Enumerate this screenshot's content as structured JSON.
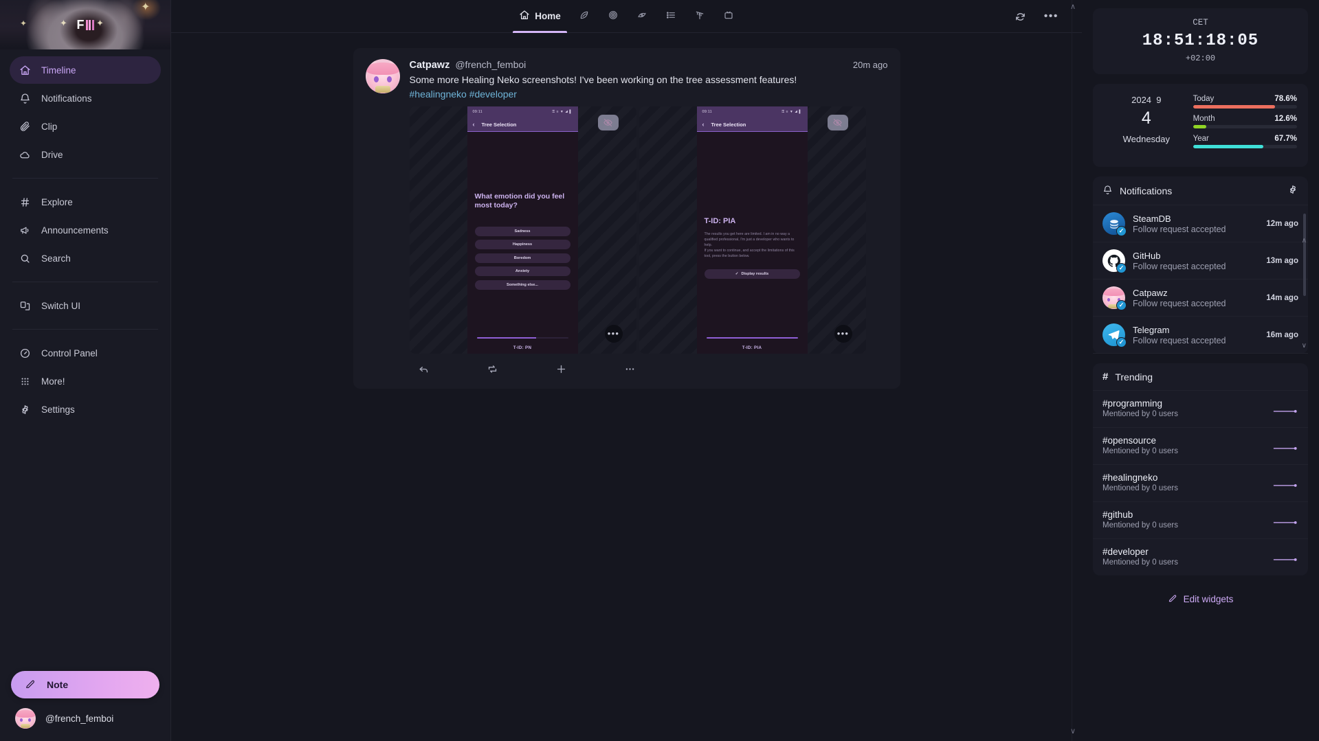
{
  "sidebar": {
    "logo": {
      "letter": "F",
      "name": "firefish-logo"
    },
    "groups": [
      {
        "items": [
          {
            "label": "Timeline",
            "icon": "home-icon",
            "active": true
          },
          {
            "label": "Notifications",
            "icon": "bell-icon",
            "active": false
          },
          {
            "label": "Clip",
            "icon": "paperclip-icon",
            "active": false
          },
          {
            "label": "Drive",
            "icon": "cloud-icon",
            "active": false
          }
        ]
      },
      {
        "items": [
          {
            "label": "Explore",
            "icon": "hash-icon",
            "active": false
          },
          {
            "label": "Announcements",
            "icon": "megaphone-icon",
            "active": false
          },
          {
            "label": "Search",
            "icon": "search-icon",
            "active": false
          }
        ]
      },
      {
        "items": [
          {
            "label": "Switch UI",
            "icon": "switch-ui-icon",
            "active": false
          }
        ]
      },
      {
        "items": [
          {
            "label": "Control Panel",
            "icon": "gauge-icon",
            "active": false
          },
          {
            "label": "More!",
            "icon": "grid-dots-icon",
            "active": false
          },
          {
            "label": "Settings",
            "icon": "gear-icon",
            "active": false
          }
        ]
      }
    ],
    "note_button": {
      "label": "Note",
      "icon": "pencil-icon"
    },
    "account": {
      "handle": "@french_femboi"
    }
  },
  "topbar": {
    "tabs": [
      {
        "label": "Home",
        "icon": "home-icon",
        "active": true
      },
      {
        "label": "",
        "icon": "leaf-icon",
        "active": false
      },
      {
        "label": "",
        "icon": "globe-icon",
        "active": false
      },
      {
        "label": "",
        "icon": "spiral-icon",
        "active": false
      },
      {
        "label": "",
        "icon": "list-icon",
        "active": false
      },
      {
        "label": "",
        "icon": "antenna-icon",
        "active": false
      },
      {
        "label": "",
        "icon": "channel-icon",
        "active": false
      }
    ],
    "refresh": "refresh-icon",
    "menu": "•••"
  },
  "post": {
    "author_name": "Catpawz",
    "author_handle": "@french_femboi",
    "timestamp": "20m ago",
    "text": "Some more Healing Neko screenshots! I've been working on the tree assessment features!",
    "tags": [
      "#healingneko",
      "#developer"
    ],
    "media": [
      {
        "hidden_icon": "eye-off-icon",
        "more_icon": "•••",
        "phone": {
          "status_time": "09:11",
          "status_icons": "⚿ ≡ ▼ ◢ ▌",
          "appbar_title": "Tree Selection",
          "back_icon": "‹",
          "heading": "What emotion did you feel most today?",
          "options": [
            "Sadness",
            "Happiness",
            "Boredom",
            "Anxiety",
            "Something else..."
          ],
          "progress_percent": 65,
          "footer": "T-ID: PN"
        }
      },
      {
        "hidden_icon": "eye-off-icon",
        "more_icon": "•••",
        "phone": {
          "status_time": "09:11",
          "status_icons": "⚿ ≡ ▼ ◢ ▌",
          "appbar_title": "Tree Selection",
          "back_icon": "‹",
          "heading": "T-ID: PIA",
          "paragraph": "The results you get here are limited. I am in no way a qualified professional, I'm just a developer who wants to help.\nIf you want to continue, and accept the limitations of this tool, press the button below.",
          "cta": "Display results",
          "cta_icon": "check-icon",
          "progress_percent": 100,
          "footer": "T-ID: PIA"
        }
      }
    ],
    "actions": [
      {
        "name": "reply",
        "icon": "reply-arrow-icon"
      },
      {
        "name": "renote",
        "icon": "repeat-icon"
      },
      {
        "name": "react",
        "icon": "plus-icon"
      },
      {
        "name": "more",
        "icon": "ellipsis-icon"
      }
    ]
  },
  "widgets": {
    "clock": {
      "timezone": "CET",
      "time": "18:51:18:05",
      "offset": "+02:00"
    },
    "calendar": {
      "year": "2024",
      "month": "9",
      "day": "4",
      "weekday": "Wednesday",
      "bars": [
        {
          "label": "Today",
          "value": "78.6%",
          "percent": 78.6,
          "color": "#ec6f5e"
        },
        {
          "label": "Month",
          "value": "12.6%",
          "percent": 12.6,
          "color": "#8fd425"
        },
        {
          "label": "Year",
          "value": "67.7%",
          "percent": 67.7,
          "color": "#3fe0d8"
        }
      ]
    },
    "notifications": {
      "title": "Notifications",
      "icon": "bell-icon",
      "settings_icon": "gear-icon",
      "items": [
        {
          "name": "SteamDB",
          "text": "Follow request accepted",
          "time": "12m ago",
          "avatar": "steamdb-avatar",
          "color": "#1b6fc4",
          "badge": "check-icon"
        },
        {
          "name": "GitHub",
          "text": "Follow request accepted",
          "time": "13m ago",
          "avatar": "github-avatar",
          "color": "#ffffff",
          "badge": "check-icon"
        },
        {
          "name": "Catpawz",
          "text": "Follow request accepted",
          "time": "14m ago",
          "avatar": "catpawz-avatar",
          "color": "#f3c4d7",
          "badge": "check-icon"
        },
        {
          "name": "Telegram",
          "text": "Follow request accepted",
          "time": "16m ago",
          "avatar": "telegram-avatar",
          "color": "#29a6e0",
          "badge": "check-icon"
        }
      ]
    },
    "trending": {
      "title": "Trending",
      "icon": "hash-icon",
      "items": [
        {
          "tag": "#programming",
          "sub": "Mentioned by 0 users"
        },
        {
          "tag": "#opensource",
          "sub": "Mentioned by 0 users"
        },
        {
          "tag": "#healingneko",
          "sub": "Mentioned by 0 users"
        },
        {
          "tag": "#github",
          "sub": "Mentioned by 0 users"
        },
        {
          "tag": "#developer",
          "sub": "Mentioned by 0 users"
        }
      ]
    },
    "edit_widgets": {
      "label": "Edit widgets",
      "icon": "pencil-icon"
    }
  }
}
